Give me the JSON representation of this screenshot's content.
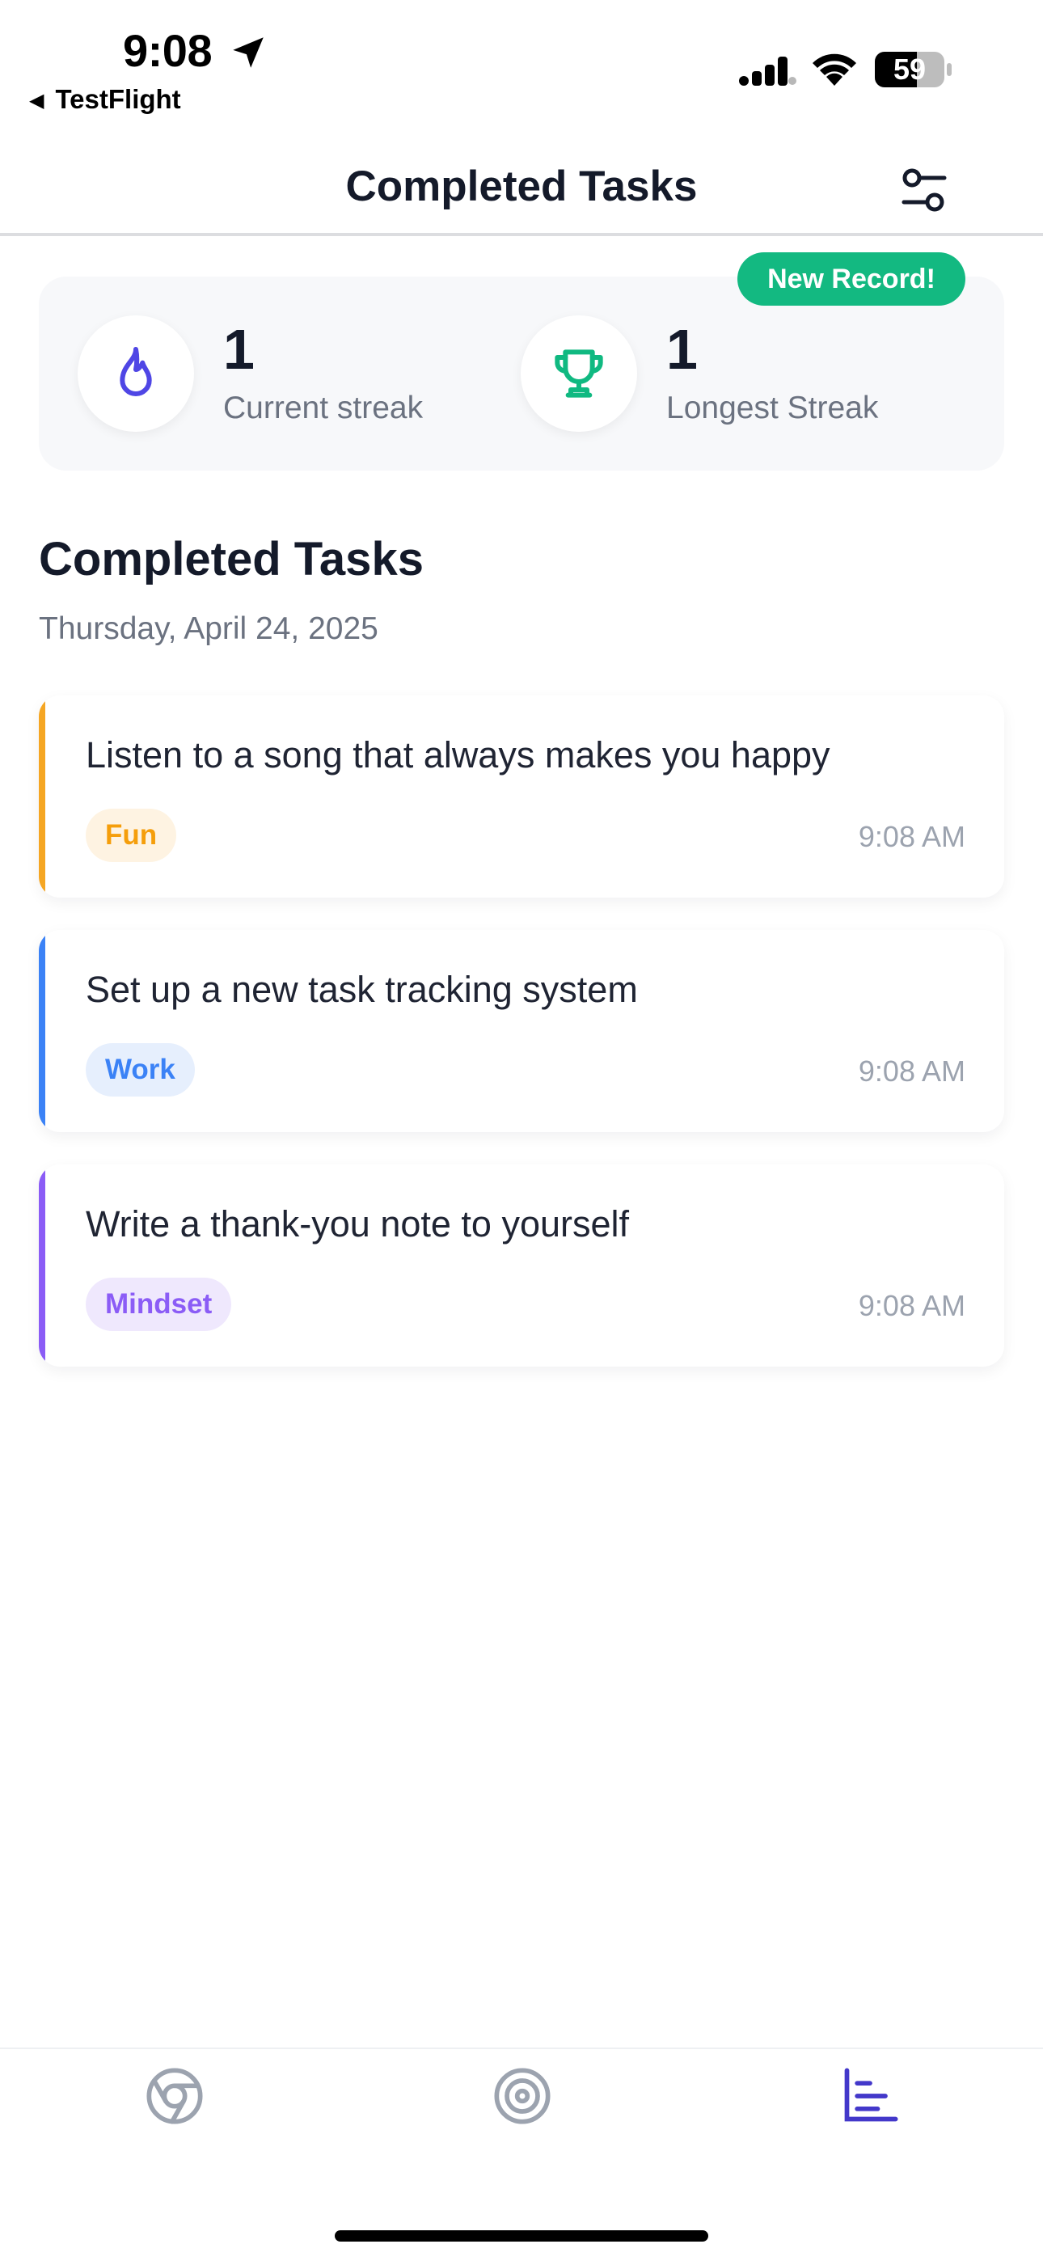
{
  "status_bar": {
    "time": "9:08",
    "back_app": "TestFlight",
    "battery": "59"
  },
  "header": {
    "title": "Completed Tasks",
    "filter_icon": "sliders-icon"
  },
  "streaks": {
    "badge": "New Record!",
    "current": {
      "value": "1",
      "label": "Current streak",
      "icon": "flame-icon"
    },
    "longest": {
      "value": "1",
      "label": "Longest Streak",
      "icon": "trophy-icon"
    }
  },
  "section": {
    "title": "Completed Tasks",
    "date": "Thursday, April 24, 2025"
  },
  "tasks": [
    {
      "title": "Listen to a song that always makes you happy",
      "tag": "Fun",
      "time": "9:08 AM",
      "accent": "#f5a623",
      "chip_bg": "#fef3e2",
      "chip_fg": "#f59e0b"
    },
    {
      "title": "Set up a new task tracking system",
      "tag": "Work",
      "time": "9:08 AM",
      "accent": "#3b82f6",
      "chip_bg": "#e6effd",
      "chip_fg": "#3b82f6"
    },
    {
      "title": "Write a thank-you note to yourself",
      "tag": "Mindset",
      "time": "9:08 AM",
      "accent": "#8b5cf6",
      "chip_bg": "#efe8fd",
      "chip_fg": "#8b5cf6"
    }
  ],
  "tab_bar": {
    "items": [
      {
        "icon": "aperture-icon",
        "active": false
      },
      {
        "icon": "target-icon",
        "active": false
      },
      {
        "icon": "bar-chart-icon",
        "active": true
      }
    ],
    "active_color": "#4338ca",
    "inactive_color": "#9ca3af"
  },
  "colors": {
    "accent_green": "#13b981",
    "flame": "#4f46e5",
    "trophy": "#10b981"
  }
}
